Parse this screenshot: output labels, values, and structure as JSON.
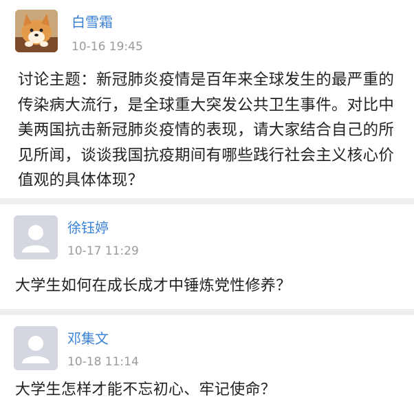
{
  "posts": [
    {
      "username": "白雪霜",
      "timestamp": "10-16 19:45",
      "avatar_icon": "shiba-dog-avatar-icon",
      "content": "讨论主题：新冠肺炎疫情是百年来全球发生的最严重的传染病大流行，是全球重大突发公共卫生事件。对比中美两国抗击新冠肺炎疫情的表现，请大家结合自己的所见所闻，谈谈我国抗疫期间有哪些践行社会主义核心价值观的具体体现？"
    },
    {
      "username": "徐钰婷",
      "timestamp": "10-17 11:29",
      "avatar_icon": "default-user-avatar-icon",
      "content": "大学生如何在成长成才中锤炼党性修养？"
    },
    {
      "username": "邓集文",
      "timestamp": "10-18 11:14",
      "avatar_icon": "default-user-avatar-icon",
      "content": "大学生怎样才能不忘初心、牢记使命？"
    }
  ],
  "colors": {
    "username": "#3b82d6",
    "timestamp": "#9a9a9a",
    "text": "#222222",
    "divider": "#efeff2",
    "default_avatar_bg": "#d4d7e0"
  }
}
